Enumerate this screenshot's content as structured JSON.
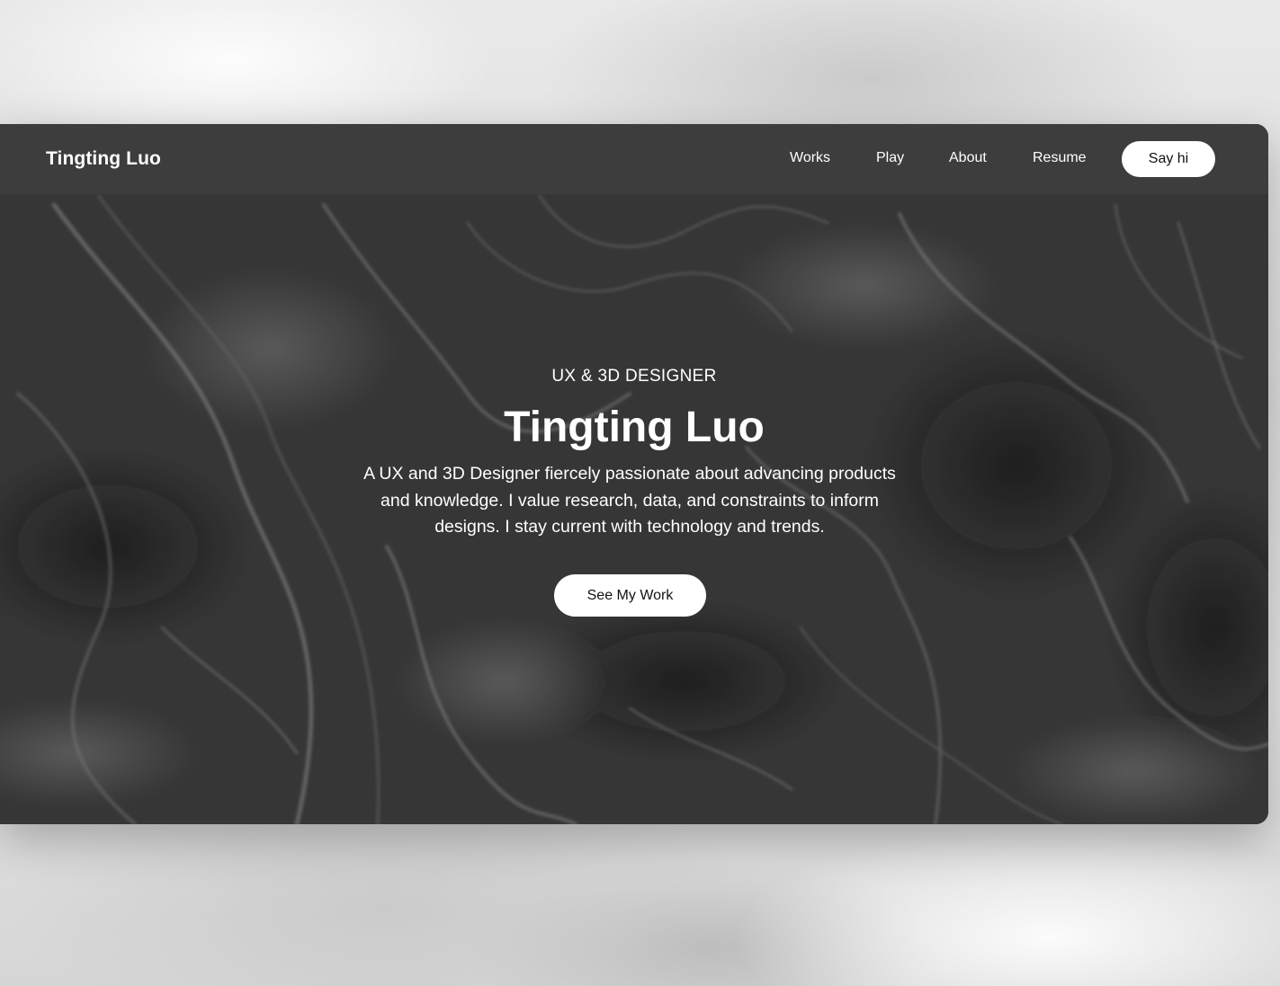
{
  "navbar": {
    "brand": "Tingting Luo",
    "links": [
      "Works",
      "Play",
      "About",
      "Resume"
    ],
    "cta_label": "Say hi"
  },
  "hero": {
    "eyebrow": "UX & 3D DESIGNER",
    "title": "Tingting Luo",
    "description": "A UX and 3D Designer fiercely passionate about advancing products and knowledge. I value research, data, and constraints to inform designs. I stay current with technology and trends.",
    "cta_label": "See My Work"
  },
  "colors": {
    "page_background": "#e4e4e4",
    "navbar_background": "#3e3e3e",
    "hero_background": "#3a3a3a",
    "button_background": "#ffffff",
    "text_light": "#ffffff",
    "text_dark": "#111111"
  }
}
